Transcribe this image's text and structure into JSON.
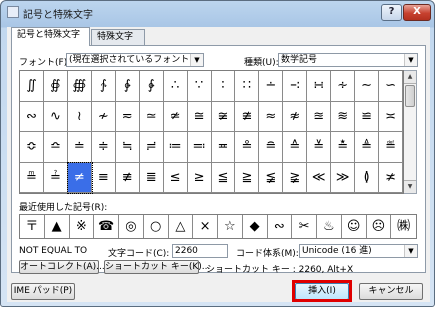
{
  "window": {
    "title": "記号と特殊文字",
    "help_label": "?",
    "close_label": "X"
  },
  "tabs": [
    {
      "label": "記号と特殊文字",
      "active": true
    },
    {
      "label": "特殊文字",
      "active": false
    }
  ],
  "font": {
    "label": "フォント(F):",
    "value": "(現在選択されているフォント)"
  },
  "subset": {
    "label": "種類(U):",
    "value": "数学記号"
  },
  "symbols": [
    [
      "∬",
      "∯",
      "∰",
      "∱",
      "∲",
      "∳",
      "∴",
      "∵",
      "∶",
      "∷",
      "∸",
      "∹",
      "∺",
      "∻",
      "∼",
      "∽"
    ],
    [
      "∾",
      "∿",
      "≀",
      "≁",
      "≂",
      "≃",
      "≄",
      "≅",
      "≆",
      "≇",
      "≈",
      "≉",
      "≊",
      "≋",
      "≌",
      "≍"
    ],
    [
      "≎",
      "≏",
      "≐",
      "≑",
      "≒",
      "≓",
      "≔",
      "≕",
      "≖",
      "≗",
      "≘",
      "≙",
      "≚",
      "≛",
      "≜",
      "≝"
    ],
    [
      "≞",
      "≟",
      "≠",
      "≡",
      "≢",
      "≣",
      "≤",
      "≥",
      "≦",
      "≧",
      "≨",
      "≩",
      "≪",
      "≫",
      "≬",
      "≭"
    ]
  ],
  "selected_symbol": "≠",
  "recent": {
    "label": "最近使用した記号(R):",
    "symbols": [
      "〒",
      "▲",
      "※",
      "☎",
      "◎",
      "○",
      "△",
      "×",
      "☆",
      "◆",
      "∾",
      "✂",
      "♨",
      "☺",
      "☹",
      "㈱"
    ]
  },
  "char_name": "NOT EQUAL TO",
  "char_code": {
    "label": "文字コード(C):",
    "value": "2260"
  },
  "encoding": {
    "label": "コード体系(M):",
    "value": "Unicode (16 進)"
  },
  "autocorrect_label": "オートコレクト(A)...",
  "shortcut_key_label": "ショートカット キー(K)...",
  "shortcut_text": "ショートカット キー : 2260, Alt+X",
  "ime_pad_label": "IME パッド(P)",
  "insert_label": "挿入(I)",
  "cancel_label": "キャンセル",
  "colors": {
    "selection": "#3a6ee8",
    "highlight": "#e00000"
  }
}
